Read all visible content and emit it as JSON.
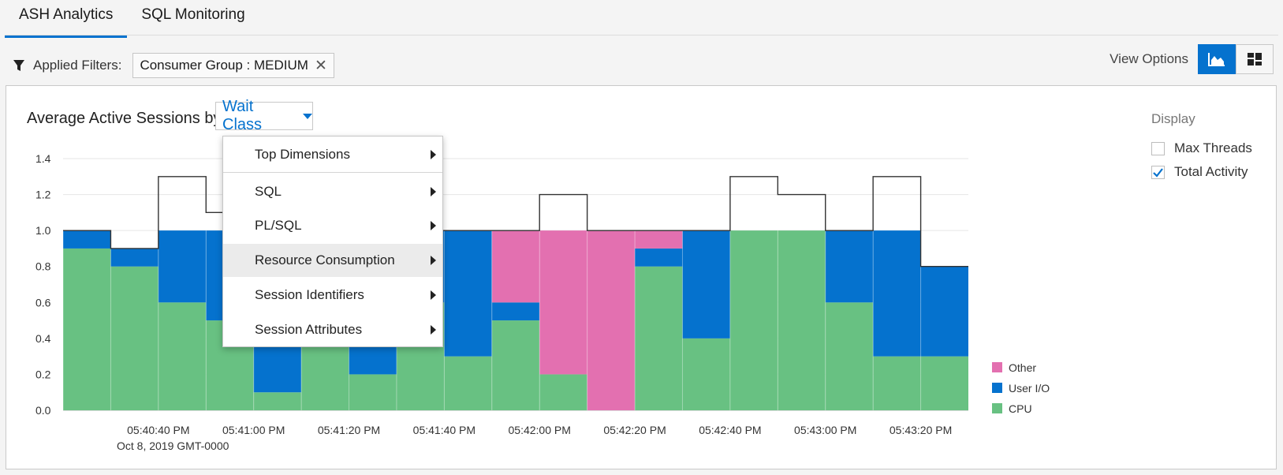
{
  "tabs": [
    {
      "label": "ASH Analytics",
      "active": true
    },
    {
      "label": "SQL Monitoring",
      "active": false
    }
  ],
  "filters": {
    "label": "Applied Filters:",
    "chips": [
      {
        "label": "Consumer Group : MEDIUM"
      }
    ]
  },
  "view_options": {
    "label": "View Options",
    "buttons": [
      "chart-view-icon",
      "tiles-view-icon"
    ],
    "active": "chart-view-icon"
  },
  "chart_header": {
    "title": "Average Active Sessions by",
    "dimension": "Wait Class"
  },
  "dimension_menu": {
    "items": [
      {
        "label": "Top Dimensions",
        "highlighted": false
      },
      {
        "label": "SQL",
        "highlighted": false
      },
      {
        "label": "PL/SQL",
        "highlighted": false
      },
      {
        "label": "Resource Consumption",
        "highlighted": true
      },
      {
        "label": "Session Identifiers",
        "highlighted": false
      },
      {
        "label": "Session Attributes",
        "highlighted": false
      }
    ]
  },
  "display": {
    "title": "Display",
    "options": [
      {
        "label": "Max Threads",
        "checked": false
      },
      {
        "label": "Total Activity",
        "checked": true
      }
    ]
  },
  "colors": {
    "accent": "#0572ce",
    "CPU": "#68c182",
    "User I/O": "#0572ce",
    "Other": "#e370b0"
  },
  "chart_data": {
    "type": "bar",
    "stacked": true,
    "ylim": [
      0,
      1.4
    ],
    "y_ticks": [
      "0.0",
      "0.2",
      "0.4",
      "0.6",
      "0.8",
      "1.0",
      "1.2",
      "1.4"
    ],
    "x_tick_labels": [
      "05:40:40 PM",
      "05:41:00 PM",
      "05:41:20 PM",
      "05:41:40 PM",
      "05:42:00 PM",
      "05:42:20 PM",
      "05:42:40 PM",
      "05:43:00 PM",
      "05:43:20 PM"
    ],
    "x_sublabel": "Oct 8, 2019 GMT-0000",
    "grid": true,
    "legend_position": "bottom-right",
    "series": [
      {
        "name": "Other",
        "color": "#e370b0",
        "values": [
          0,
          0,
          0,
          0,
          0,
          0,
          0,
          0,
          0,
          0.4,
          0.8,
          1.0,
          0.1,
          0,
          0,
          0,
          0,
          0,
          0
        ]
      },
      {
        "name": "User I/O",
        "color": "#0572ce",
        "values": [
          0.1,
          0.1,
          0.4,
          0.5,
          0.9,
          0.7,
          0.8,
          0.4,
          0.7,
          0.1,
          0,
          0,
          0.1,
          0.6,
          0,
          0,
          0.4,
          0.7,
          0.5
        ]
      },
      {
        "name": "CPU",
        "color": "#68c182",
        "values": [
          0.9,
          0.8,
          0.6,
          0.5,
          0.1,
          0.4,
          0.2,
          0.6,
          0.3,
          0.5,
          0.2,
          0,
          0.8,
          0.4,
          1.0,
          1.0,
          0.6,
          0.3,
          0.3
        ]
      }
    ],
    "total_activity": [
      1.0,
      0.9,
      1.3,
      1.1,
      1.0,
      1.0,
      1.0,
      1.0,
      1.0,
      1.0,
      1.2,
      1.0,
      1.0,
      1.0,
      1.3,
      1.2,
      1.0,
      1.3,
      0.8
    ]
  }
}
